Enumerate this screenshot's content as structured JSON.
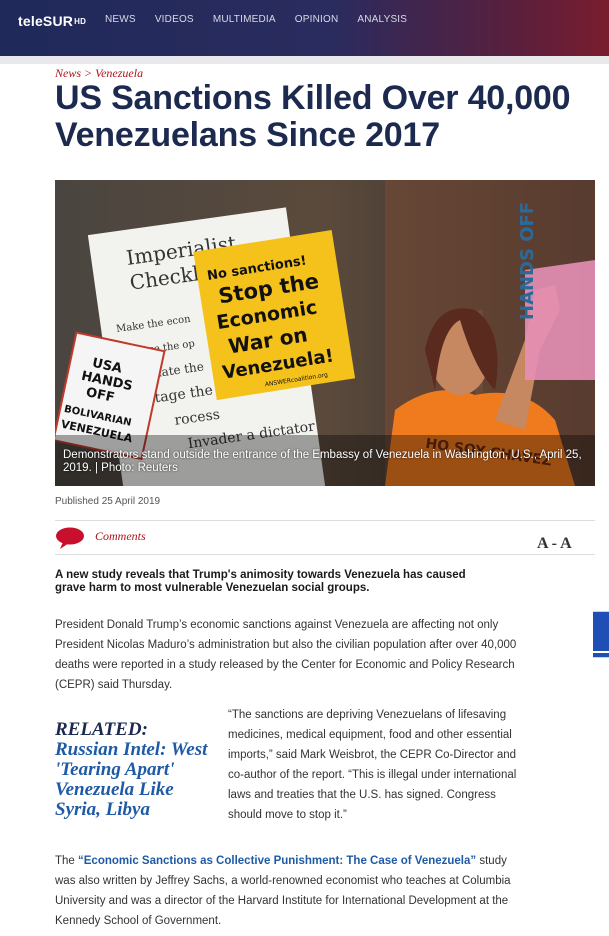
{
  "header": {
    "logo": "teleSUR",
    "logo_suffix": "HD",
    "nav": [
      "NEWS",
      "VIDEOS",
      "MULTIMEDIA",
      "OPINION",
      "ANALYSIS"
    ]
  },
  "article": {
    "breadcrumb": "News > Venezuela",
    "title": "US Sanctions Killed Over 40,000 Venezuelans Since 2017",
    "photo": {
      "caption": "Demonstrators stand outside the entrance of the Embassy of Venezuela in Washington, U.S., April 25, 2019. | Photo: Reuters",
      "sign_text": "No sanctions! Stop the Economic War on Venezuela!",
      "sign_small": "ANSWERcoalition.org",
      "board_text": [
        "Imperialist",
        "Checklist",
        "Make the econ",
        "Finance the op",
        "ssinate the",
        "otage the",
        "Invader a dictator",
        "rocess"
      ],
      "left_sign": [
        "USA",
        "HANDS",
        "OFF",
        "BOLIVARIAN",
        "VENEZUELA"
      ],
      "shirt_text": "HO SOY CHAVEZ",
      "banner_text": "HANDS OFF"
    },
    "published": "Published 25 April 2019",
    "comments_label": "Comments",
    "font_size_control": "A - A",
    "lead": "A new study reveals that Trump's animosity towards Venezuela has caused grave harm to most vulnerable Venezuelan social groups.",
    "p1": "President Donald Trump’s economic sanctions against Venezuela are affecting not only President Nicolas Maduro’s administration but also the civilian population after over 40,000 deaths were reported in a study released by the Center for Economic and Policy Research (CEPR) said Thursday.",
    "p2": "“The sanctions are depriving Venezuelans of lifesaving medicines, medical equipment, food and other essential imports,” said Mark Weisbrot, the CEPR Co-Director and co-author of the report. “This is illegal under international laws and treaties that the U.S. has signed. Congress should move to stop it.”",
    "related": {
      "label": "RELATED:",
      "link": "Russian Intel: West 'Tearing Apart' Venezuela Like Syria, Libya"
    },
    "p3": {
      "before": "The ",
      "link": "“Economic Sanctions as Collective Punishment: The Case of Venezuela”",
      "after": " study was also written by Jeffrey Sachs, a world-renowned economist who teaches at Columbia University and was a director of the Harvard Institute for International Development at the Kennedy School of Government."
    }
  },
  "colors": {
    "header_navy": "#1f2a5a",
    "header_red": "#7a1d2e",
    "title_navy": "#1b2a4e",
    "accent_red": "#b0121b",
    "link_blue": "#1f5aa6"
  }
}
